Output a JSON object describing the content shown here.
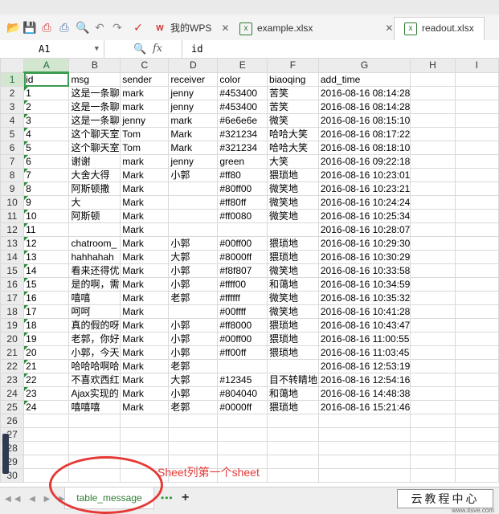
{
  "tabs": [
    {
      "label": "我的WPS",
      "icon": "wps-icon"
    },
    {
      "label": "example.xlsx",
      "icon": "excel-file-icon"
    },
    {
      "label": "readout.xlsx",
      "icon": "excel-file-icon",
      "active": true
    }
  ],
  "formula_bar": {
    "cell_ref": "A1",
    "fx": "fx",
    "value": "id"
  },
  "columns": [
    "A",
    "B",
    "C",
    "D",
    "E",
    "F",
    "G",
    "H",
    "I"
  ],
  "header_row": [
    "id",
    "msg",
    "sender",
    "receiver",
    "color",
    "biaoqing",
    "add_time",
    "",
    ""
  ],
  "rows": [
    [
      "1",
      "这是一条聊",
      "mark",
      "jenny",
      "#453400",
      "苦笑",
      "2016-08-16 08:14:28"
    ],
    [
      "2",
      "这是一条聊",
      "mark",
      "jenny",
      "#453400",
      "苦笑",
      "2016-08-16 08:14:28"
    ],
    [
      "3",
      "这是一条聊",
      "jenny",
      "mark",
      "#6e6e6e",
      "微笑",
      "2016-08-16 08:15:10"
    ],
    [
      "4",
      "这个聊天室",
      "Tom",
      "Mark",
      "#321234",
      "哈哈大笑",
      "2016-08-16 08:17:22"
    ],
    [
      "5",
      "这个聊天室",
      "Tom",
      "Mark",
      "#321234",
      "哈哈大笑",
      "2016-08-16 08:18:10"
    ],
    [
      "6",
      "谢谢",
      "mark",
      "jenny",
      "green",
      "大笑",
      "2016-08-16 09:22:18"
    ],
    [
      "7",
      "大舍大得",
      "Mark",
      "小郭",
      "#ff80",
      "猥琐地",
      "2016-08-16 10:23:01"
    ],
    [
      "8",
      "阿斯顿撒",
      "Mark",
      "",
      "#80ff00",
      "微笑地",
      "2016-08-16 10:23:21"
    ],
    [
      "9",
      "大",
      "Mark",
      "",
      "#ff80ff",
      "微笑地",
      "2016-08-16 10:24:24"
    ],
    [
      "10",
      "阿斯顿",
      "Mark",
      "",
      "#ff0080",
      "微笑地",
      "2016-08-16 10:25:34"
    ],
    [
      "11",
      "",
      "Mark",
      "",
      "",
      "",
      "2016-08-16 10:28:07"
    ],
    [
      "12",
      "chatroom_",
      "Mark",
      "小郭",
      "#00ff00",
      "猥琐地",
      "2016-08-16 10:29:30"
    ],
    [
      "13",
      "hahhahah",
      "Mark",
      "大郭",
      "#8000ff",
      "猥琐地",
      "2016-08-16 10:30:29"
    ],
    [
      "14",
      "看来还得优",
      "Mark",
      "小郭",
      "#f8f807",
      "微笑地",
      "2016-08-16 10:33:58"
    ],
    [
      "15",
      "是的啊，需",
      "Mark",
      "小郭",
      "#ffff00",
      "和蔼地",
      "2016-08-16 10:34:59"
    ],
    [
      "16",
      "嘻嘻",
      "Mark",
      "老郭",
      "#ffffff",
      "微笑地",
      "2016-08-16 10:35:32"
    ],
    [
      "17",
      "呵呵",
      "Mark",
      "",
      "#00ffff",
      "微笑地",
      "2016-08-16 10:41:28"
    ],
    [
      "18",
      "真的假的呀",
      "Mark",
      "小郭",
      "#ff8000",
      "猥琐地",
      "2016-08-16 10:43:47"
    ],
    [
      "19",
      "老郭，你好",
      "Mark",
      "小郭",
      "#00ff00",
      "猥琐地",
      "2016-08-16 11:00:55"
    ],
    [
      "20",
      "小郭，今天",
      "Mark",
      "小郭",
      "#ff00ff",
      "猥琐地",
      "2016-08-16 11:03:45"
    ],
    [
      "21",
      "哈哈哈啊哈",
      "Mark",
      "老郭",
      "",
      "",
      "2016-08-16 12:53:19"
    ],
    [
      "22",
      "不喜欢西红",
      "Mark",
      "大郭",
      "#12345",
      "目不转睛地",
      "2016-08-16 12:54:16"
    ],
    [
      "23",
      "Ajax实现的",
      "Mark",
      "小郭",
      "#804040",
      "和蔼地",
      "2016-08-16 14:48:38"
    ],
    [
      "24",
      "嘻嘻嘻",
      "Mark",
      "老郭",
      "#0000ff",
      "猥琐地",
      "2016-08-16 15:21:46"
    ]
  ],
  "row_numbers": [
    "1",
    "2",
    "3",
    "4",
    "5",
    "6",
    "7",
    "8",
    "9",
    "10",
    "11",
    "12",
    "13",
    "14",
    "15",
    "16",
    "17",
    "18",
    "19",
    "20",
    "21",
    "22",
    "23",
    "24",
    "25",
    "26",
    "27",
    "28",
    "29",
    "30"
  ],
  "sheet_tab": "table_message",
  "annotation": "Sheet列第一个sheet",
  "brand": "云教程中心",
  "watermark": "www.itsve.com"
}
